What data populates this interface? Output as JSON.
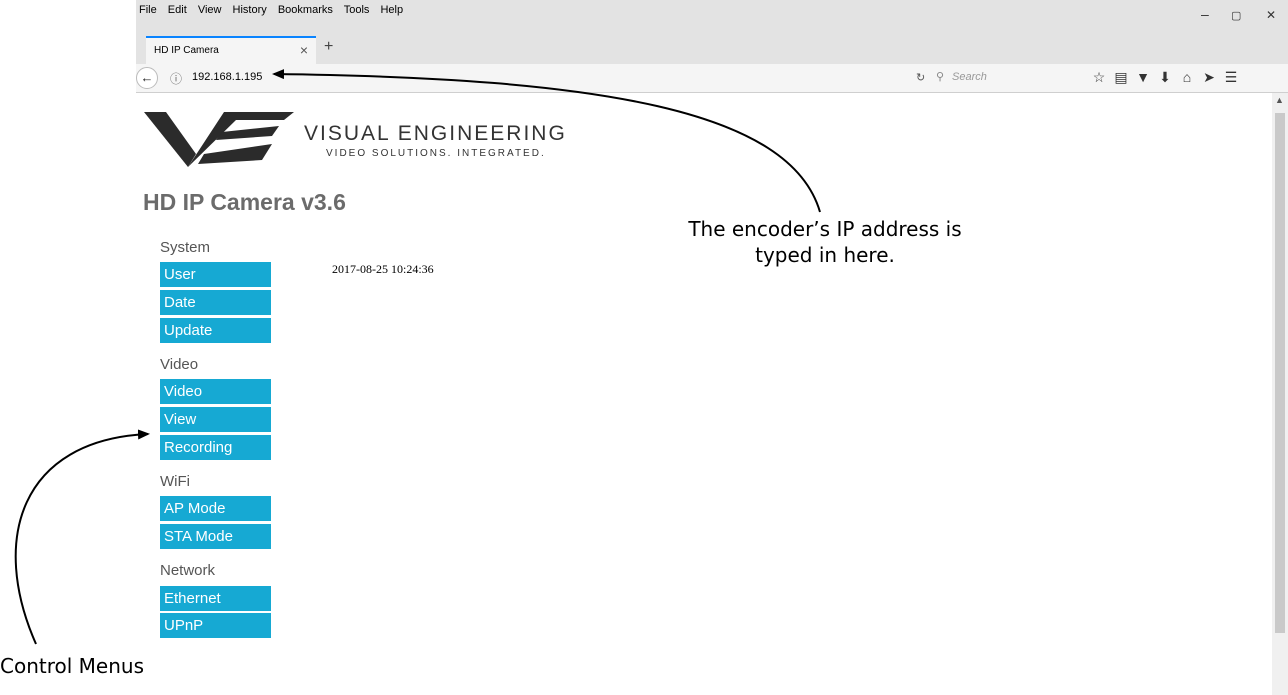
{
  "browser": {
    "menu": [
      "File",
      "Edit",
      "View",
      "History",
      "Bookmarks",
      "Tools",
      "Help"
    ],
    "window_controls": [
      "–",
      "▢",
      "✕"
    ],
    "tab": {
      "title": "HD IP Camera",
      "close": "×"
    },
    "new_tab": "+",
    "address": "192.168.1.195",
    "search_placeholder": "Search",
    "toolbar_icons": [
      "bookmark-star-icon",
      "reading-list-icon",
      "pocket-icon",
      "download-icon",
      "home-icon",
      "send-icon",
      "hamburger-menu-icon"
    ]
  },
  "page": {
    "brand_name": "VISUAL ENGINEERING",
    "brand_tagline": "VIDEO SOLUTIONS. INTEGRATED.",
    "title": "HD IP Camera v3.6",
    "datetime": "2017-08-25 10:24:36",
    "nav": [
      {
        "group": "System",
        "items": [
          "User",
          "Date",
          "Update"
        ]
      },
      {
        "group": "Video",
        "items": [
          "Video",
          "View",
          "Recording"
        ]
      },
      {
        "group": "WiFi",
        "items": [
          "AP Mode",
          "STA Mode"
        ]
      },
      {
        "group": "Network",
        "items": [
          "Ethernet",
          "UPnP"
        ]
      }
    ],
    "accent_color": "#16a9d3"
  },
  "annotations": {
    "ip_note_line1": "The encoder’s IP address is",
    "ip_note_line2": "typed in here.",
    "menu_note": "Control Menus"
  }
}
